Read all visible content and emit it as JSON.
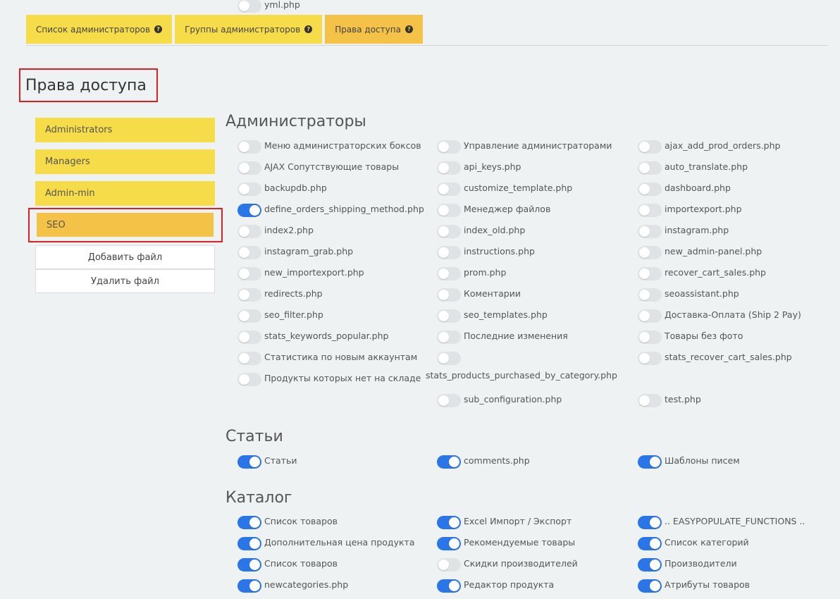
{
  "tabs": [
    {
      "label": "Список администраторов",
      "active": false
    },
    {
      "label": "Группы администраторов",
      "active": false
    },
    {
      "label": "Права доступа",
      "active": true
    }
  ],
  "help_icon_glyph": "?",
  "page_title": "Права доступа",
  "groups": [
    "Administrators",
    "Managers",
    "Admin-min",
    "SEO"
  ],
  "buttons": {
    "add_file": "Добавить файл",
    "delete_file": "Удалить файл"
  },
  "sections": [
    {
      "title": "Администраторы",
      "items": [
        {
          "label": "Меню администраторских боксов",
          "on": false
        },
        {
          "label": "Управление администраторами",
          "on": false
        },
        {
          "label": "ajax_add_prod_orders.php",
          "on": false
        },
        {
          "label": "AJAX Сопутствующие товары",
          "on": false
        },
        {
          "label": "api_keys.php",
          "on": false
        },
        {
          "label": "auto_translate.php",
          "on": false
        },
        {
          "label": "backupdb.php",
          "on": false
        },
        {
          "label": "customize_template.php",
          "on": false
        },
        {
          "label": "dashboard.php",
          "on": false
        },
        {
          "label": "define_orders_shipping_method.php",
          "on": true
        },
        {
          "label": "Менеджер файлов",
          "on": false
        },
        {
          "label": "importexport.php",
          "on": false
        },
        {
          "label": "index2.php",
          "on": false
        },
        {
          "label": "index_old.php",
          "on": false
        },
        {
          "label": "instagram.php",
          "on": false
        },
        {
          "label": "instagram_grab.php",
          "on": false
        },
        {
          "label": "instructions.php",
          "on": false
        },
        {
          "label": "new_admin-panel.php",
          "on": false
        },
        {
          "label": "new_importexport.php",
          "on": false
        },
        {
          "label": "prom.php",
          "on": false
        },
        {
          "label": "recover_cart_sales.php",
          "on": false
        },
        {
          "label": "redirects.php",
          "on": false
        },
        {
          "label": "Коментарии",
          "on": false
        },
        {
          "label": "seoassistant.php",
          "on": false
        },
        {
          "label": "seo_filter.php",
          "on": false
        },
        {
          "label": "seo_templates.php",
          "on": false
        },
        {
          "label": "Доставка-Оплата (Ship 2 Pay)",
          "on": false
        },
        {
          "label": "stats_keywords_popular.php",
          "on": false
        },
        {
          "label": "Последние изменения",
          "on": false
        },
        {
          "label": "Товары без фото",
          "on": false
        },
        {
          "label": "Статистика по новым аккаунтам",
          "on": false
        },
        {
          "label": "stats_products_purchased_by_category.php",
          "on": false
        },
        {
          "label": "stats_recover_cart_sales.php",
          "on": false
        },
        {
          "label": "Продукты которых нет на складе",
          "on": false
        },
        {
          "label": "sub_configuration.php",
          "on": false
        },
        {
          "label": "test.php",
          "on": false
        },
        {
          "label": "yml.php",
          "on": false
        }
      ]
    },
    {
      "title": "Статьи",
      "items": [
        {
          "label": "Статьи",
          "on": true
        },
        {
          "label": "comments.php",
          "on": true
        },
        {
          "label": "Шаблоны писем",
          "on": true
        }
      ]
    },
    {
      "title": "Каталог",
      "items": [
        {
          "label": "Список товаров",
          "on": true
        },
        {
          "label": "Excel Импорт / Экспорт",
          "on": true
        },
        {
          "label": ".. EASYPOPULATE_FUNCTIONS ..",
          "on": true
        },
        {
          "label": "Дополнительная цена продукта",
          "on": true
        },
        {
          "label": "Рекомендуемые товары",
          "on": true
        },
        {
          "label": "Список категорий",
          "on": true
        },
        {
          "label": "Список товаров",
          "on": true
        },
        {
          "label": "Скидки производителей",
          "on": false
        },
        {
          "label": "Производители",
          "on": true
        },
        {
          "label": "newcategories.php",
          "on": true
        },
        {
          "label": "Редактор продукта",
          "on": true
        },
        {
          "label": "Атрибуты товаров",
          "on": true
        }
      ]
    }
  ]
}
